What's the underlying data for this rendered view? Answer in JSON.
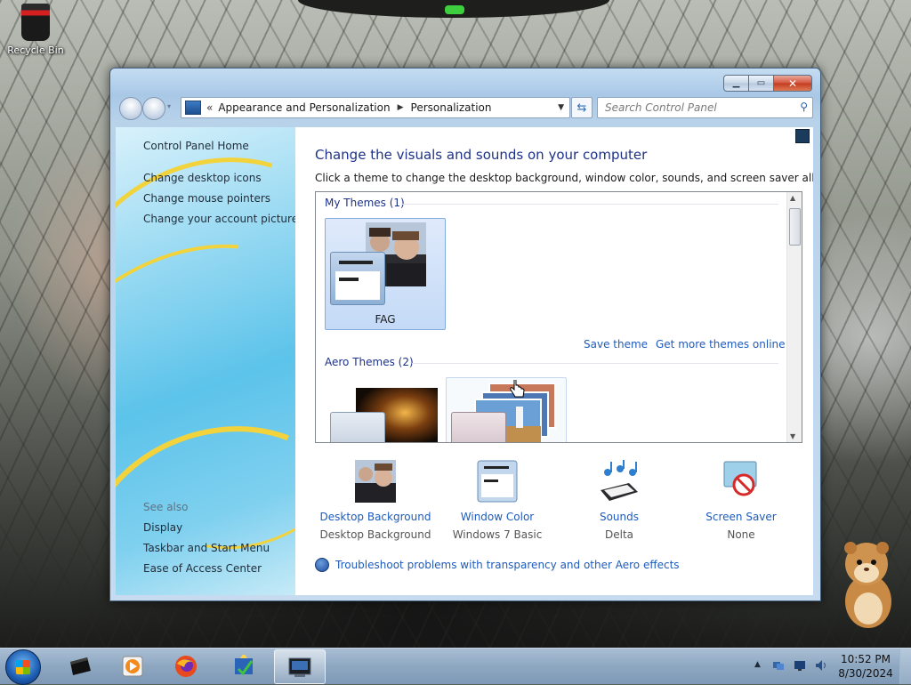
{
  "desktop": {
    "icons": [
      {
        "label": "Recycle Bin",
        "icon": "recycle-bin-icon"
      }
    ]
  },
  "window": {
    "controls": {
      "minimize": "minimize",
      "maximize": "maximize",
      "close": "close"
    },
    "address": {
      "overflow_chevron": "«",
      "crumbs": [
        "Appearance and Personalization",
        "Personalization"
      ]
    },
    "search": {
      "placeholder": "Search Control Panel"
    },
    "left_pane": {
      "home": "Control Panel Home",
      "tasks": [
        "Change desktop icons",
        "Change mouse pointers",
        "Change your account picture"
      ],
      "see_also_header": "See also",
      "see_also": [
        "Display",
        "Taskbar and Start Menu",
        "Ease of Access Center"
      ]
    },
    "main": {
      "title": "Change the visuals and sounds on your computer",
      "subtitle": "Click a theme to change the desktop background, window color, sounds, and screen saver all at once.",
      "groups": [
        {
          "header": "My Themes (1)",
          "themes": [
            {
              "name": "FAG",
              "selected": true
            }
          ]
        },
        {
          "header": "Aero Themes (2)",
          "themes": [
            {
              "name": ""
            },
            {
              "name": ""
            }
          ]
        }
      ],
      "save_theme": "Save theme",
      "get_more": "Get more themes online",
      "settings": [
        {
          "label": "Desktop Background",
          "value": "Desktop Background",
          "icon": "desktop-background-icon"
        },
        {
          "label": "Window Color",
          "value": "Windows 7 Basic",
          "icon": "window-color-icon"
        },
        {
          "label": "Sounds",
          "value": "Delta",
          "icon": "sounds-icon"
        },
        {
          "label": "Screen Saver",
          "value": "None",
          "icon": "screen-saver-icon"
        }
      ],
      "troubleshoot": "Troubleshoot problems with transparency and other Aero effects"
    }
  },
  "taskbar": {
    "pinned": [
      "media-center-icon",
      "media-player-icon",
      "firefox-icon",
      "action-center-icon",
      "control-panel-icon"
    ],
    "active_index": 4,
    "clock": {
      "time": "10:52 PM",
      "date": "8/30/2024"
    }
  },
  "colors": {
    "link": "#1e5bbd",
    "title": "#1e3287",
    "selection": "#c4daf7"
  }
}
